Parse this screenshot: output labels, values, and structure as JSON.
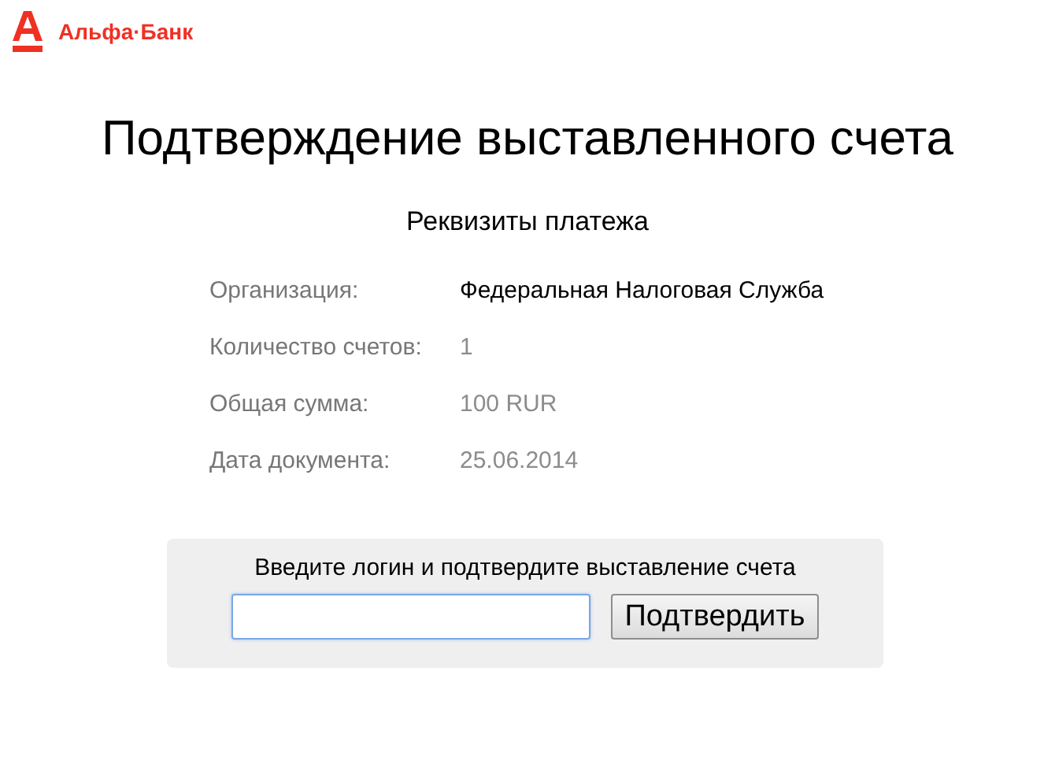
{
  "logo": {
    "text": "Альфа·Банк"
  },
  "title": "Подтверждение выставленного счета",
  "details": {
    "heading": "Реквизиты платежа",
    "rows": [
      {
        "label": "Организация:",
        "value": "Федеральная Налоговая Служба",
        "blurred": false
      },
      {
        "label": "Количество счетов:",
        "value": "1",
        "blurred": true
      },
      {
        "label": "Общая сумма:",
        "value": "100 RUR",
        "blurred": true
      },
      {
        "label": "Дата документа:",
        "value": "25.06.2014",
        "blurred": true
      }
    ]
  },
  "login": {
    "prompt": "Введите логин и подтвердите выставление счета",
    "focused": true,
    "button": "Подтвердить"
  }
}
